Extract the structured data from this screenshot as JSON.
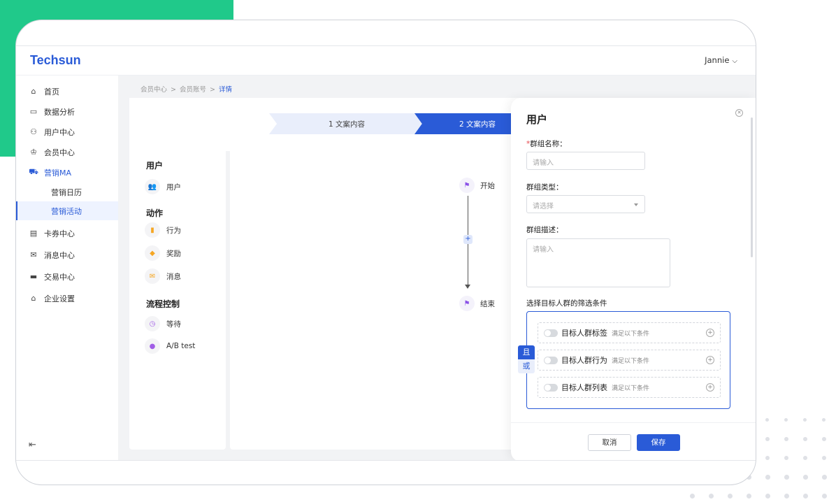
{
  "app": {
    "logo": "Techsun",
    "user_name": "Jannie"
  },
  "sidebar": {
    "items": [
      {
        "label": "首页",
        "icon": "home-icon"
      },
      {
        "label": "数据分析",
        "icon": "chart-icon"
      },
      {
        "label": "用户中心",
        "icon": "users-icon"
      },
      {
        "label": "会员中心",
        "icon": "crown-icon"
      },
      {
        "label": "营销MA",
        "icon": "cart-icon"
      },
      {
        "label": "卡券中心",
        "icon": "ticket-icon"
      },
      {
        "label": "消息中心",
        "icon": "mail-icon"
      },
      {
        "label": "交易中心",
        "icon": "card-icon"
      },
      {
        "label": "企业设置",
        "icon": "building-icon"
      }
    ],
    "sub_items": [
      {
        "label": "营销日历"
      },
      {
        "label": "营销活动"
      }
    ]
  },
  "breadcrumb": {
    "items": [
      "会员中心",
      "会员账号",
      "详情"
    ],
    "separator": ">"
  },
  "steps": [
    {
      "label": "1 文案内容"
    },
    {
      "label": "2 文案内容"
    }
  ],
  "palette": {
    "sections": [
      {
        "title": "用户",
        "items": [
          {
            "label": "用户",
            "icon": "users-icon"
          }
        ]
      },
      {
        "title": "动作",
        "items": [
          {
            "label": "行为",
            "icon": "bookmark-icon"
          },
          {
            "label": "奖励",
            "icon": "gift-icon"
          },
          {
            "label": "消息",
            "icon": "envelope-icon"
          }
        ]
      },
      {
        "title": "流程控制",
        "items": [
          {
            "label": "等待",
            "icon": "clock-icon"
          },
          {
            "label": "A/B test",
            "icon": "bulb-icon"
          }
        ]
      }
    ]
  },
  "flow": {
    "start_label": "开始",
    "end_label": "结束",
    "add_symbol": "+"
  },
  "drawer": {
    "title": "用户",
    "group_name": {
      "required_mark": "*",
      "label": "群组名称：",
      "placeholder": "请输入"
    },
    "group_type": {
      "label": "群组类型：",
      "placeholder": "请选择"
    },
    "group_desc": {
      "label": "群组描述：",
      "placeholder": "请输入"
    },
    "filter_title": "选择目标人群的筛选条件",
    "logic": {
      "and": "且",
      "or": "或"
    },
    "conditions": [
      {
        "name": "目标人群标签",
        "sub": "满足以下条件"
      },
      {
        "name": "目标人群行为",
        "sub": "满足以下条件"
      },
      {
        "name": "目标人群列表",
        "sub": "满足以下条件"
      }
    ],
    "cancel_label": "取消",
    "save_label": "保存"
  },
  "colors": {
    "primary": "#2a5bd7",
    "accent_green": "#20c98a"
  }
}
